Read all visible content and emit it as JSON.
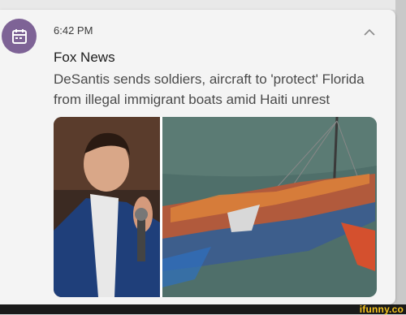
{
  "notification": {
    "time": "6:42 PM",
    "source": "Fox News",
    "headline": "DeSantis sends soldiers, aircraft to 'protect' Florida from illegal immigrant boats amid Haiti unrest",
    "app_icon": "calendar-icon",
    "collapse_icon": "chevron-up-icon"
  },
  "watermark": {
    "text": "ifunny.co"
  },
  "colors": {
    "app_icon_bg": "#7e6396",
    "card_bg": "#f4f4f4",
    "watermark": "#f4c21d"
  }
}
